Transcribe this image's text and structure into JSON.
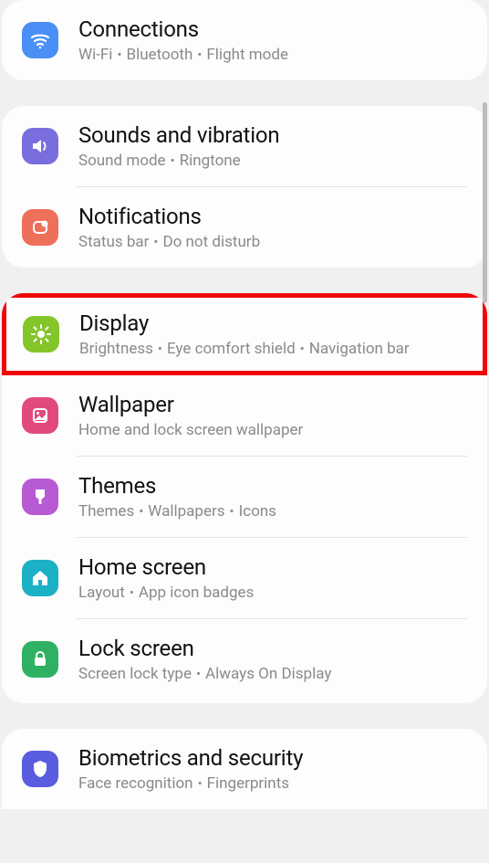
{
  "colors": {
    "connections": "#4a8ff6",
    "sounds": "#7a6ddd",
    "notifications": "#ee6f5a",
    "display": "#84c529",
    "wallpaper": "#e24a7d",
    "themes": "#b75ad4",
    "home": "#1bb1c5",
    "lock": "#2fb163",
    "biometrics": "#5a5de0"
  },
  "items": {
    "connections": {
      "title": "Connections",
      "sub1": "Wi-Fi",
      "sub2": "Bluetooth",
      "sub3": "Flight mode"
    },
    "sounds": {
      "title": "Sounds and vibration",
      "sub1": "Sound mode",
      "sub2": "Ringtone"
    },
    "notifications": {
      "title": "Notifications",
      "sub1": "Status bar",
      "sub2": "Do not disturb"
    },
    "display": {
      "title": "Display",
      "sub1": "Brightness",
      "sub2": "Eye comfort shield",
      "sub3": "Navigation bar"
    },
    "wallpaper": {
      "title": "Wallpaper",
      "sub1": "Home and lock screen wallpaper"
    },
    "themes": {
      "title": "Themes",
      "sub1": "Themes",
      "sub2": "Wallpapers",
      "sub3": "Icons"
    },
    "home": {
      "title": "Home screen",
      "sub1": "Layout",
      "sub2": "App icon badges"
    },
    "lock": {
      "title": "Lock screen",
      "sub1": "Screen lock type",
      "sub2": "Always On Display"
    },
    "biometrics": {
      "title": "Biometrics and security",
      "sub1": "Face recognition",
      "sub2": "Fingerprints"
    }
  },
  "highlighted": "display"
}
